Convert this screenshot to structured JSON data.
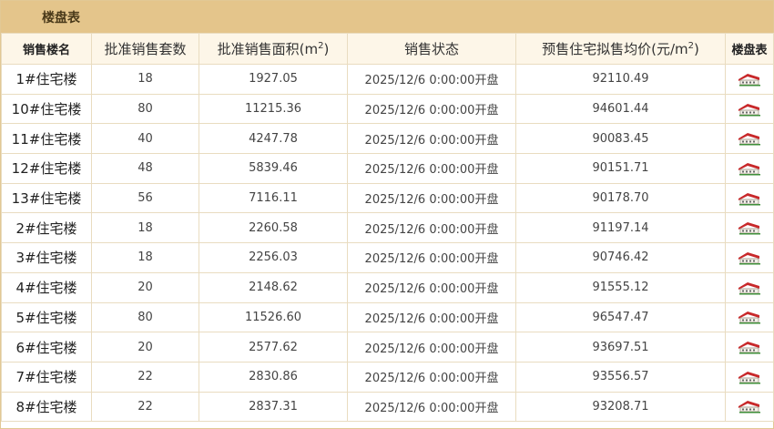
{
  "title": "楼盘表",
  "headers": {
    "building": "销售楼名",
    "approved_units": "批准销售套数",
    "approved_area": "批准销售面积(m",
    "area_sup": "2",
    "area_close": ")",
    "status": "销售状态",
    "price": "预售住宅拟售均价(元/m",
    "price_sup": "2",
    "price_close": ")",
    "table_link": "楼盘表"
  },
  "rows": [
    {
      "building": "1#住宅楼",
      "units": "18",
      "area": "1927.05",
      "status": "2025/12/6 0:00:00开盘",
      "price": "92110.49"
    },
    {
      "building": "10#住宅楼",
      "units": "80",
      "area": "11215.36",
      "status": "2025/12/6 0:00:00开盘",
      "price": "94601.44"
    },
    {
      "building": "11#住宅楼",
      "units": "40",
      "area": "4247.78",
      "status": "2025/12/6 0:00:00开盘",
      "price": "90083.45"
    },
    {
      "building": "12#住宅楼",
      "units": "48",
      "area": "5839.46",
      "status": "2025/12/6 0:00:00开盘",
      "price": "90151.71"
    },
    {
      "building": "13#住宅楼",
      "units": "56",
      "area": "7116.11",
      "status": "2025/12/6 0:00:00开盘",
      "price": "90178.70"
    },
    {
      "building": "2#住宅楼",
      "units": "18",
      "area": "2260.58",
      "status": "2025/12/6 0:00:00开盘",
      "price": "91197.14"
    },
    {
      "building": "3#住宅楼",
      "units": "18",
      "area": "2256.03",
      "status": "2025/12/6 0:00:00开盘",
      "price": "90746.42"
    },
    {
      "building": "4#住宅楼",
      "units": "20",
      "area": "2148.62",
      "status": "2025/12/6 0:00:00开盘",
      "price": "91555.12"
    },
    {
      "building": "5#住宅楼",
      "units": "80",
      "area": "11526.60",
      "status": "2025/12/6 0:00:00开盘",
      "price": "96547.47"
    },
    {
      "building": "6#住宅楼",
      "units": "20",
      "area": "2577.62",
      "status": "2025/12/6 0:00:00开盘",
      "price": "93697.51"
    },
    {
      "building": "7#住宅楼",
      "units": "22",
      "area": "2830.86",
      "status": "2025/12/6 0:00:00开盘",
      "price": "93556.57"
    },
    {
      "building": "8#住宅楼",
      "units": "22",
      "area": "2837.31",
      "status": "2025/12/6 0:00:00开盘",
      "price": "93208.71"
    }
  ],
  "icon": "house-icon",
  "colors": {
    "titlebar": "#e4c58b",
    "header_bg": "#fdf6e8",
    "border": "#e9dcc0",
    "roof": "#c8282a"
  }
}
